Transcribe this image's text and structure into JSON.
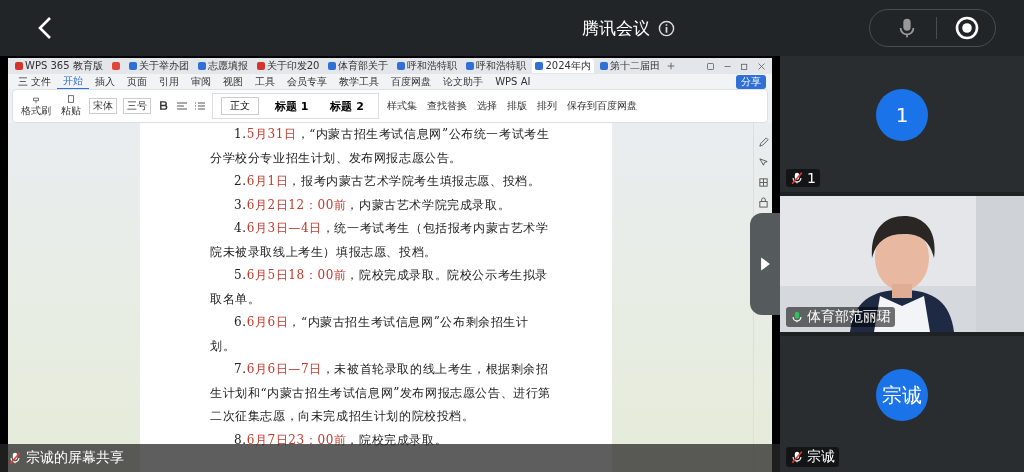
{
  "meeting": {
    "title": "腾讯会议"
  },
  "wps": {
    "tabs": [
      {
        "label": "WPS 365 教育版",
        "selected": false,
        "color": "#d6332a"
      },
      {
        "selected": false,
        "color": "#e0453a"
      },
      {
        "label": "关于举办团",
        "selected": false,
        "color": "#2f6fd6"
      },
      {
        "label": "志愿填报",
        "selected": false,
        "color": "#2f6fd6"
      },
      {
        "label": "关于印发20",
        "selected": false,
        "color": "#d6332a"
      },
      {
        "label": "体育部关于",
        "selected": false,
        "color": "#2f6fd6"
      },
      {
        "label": "呼和浩特职",
        "selected": false,
        "color": "#2f6fd6"
      },
      {
        "label": "呼和浩特职",
        "selected": false,
        "color": "#2f6fd6"
      },
      {
        "label": "2024年内",
        "selected": true,
        "color": "#2f6fd6"
      },
      {
        "label": "第十二届田",
        "selected": false,
        "color": "#2f6fd6"
      }
    ],
    "menu": [
      {
        "label": "三 文件",
        "selected": false
      },
      {
        "label": "开始",
        "selected": true
      },
      {
        "label": "插入",
        "selected": false
      },
      {
        "label": "页面",
        "selected": false
      },
      {
        "label": "引用",
        "selected": false
      },
      {
        "label": "审阅",
        "selected": false
      },
      {
        "label": "视图",
        "selected": false
      },
      {
        "label": "工具",
        "selected": false
      },
      {
        "label": "会员专享",
        "selected": false
      },
      {
        "label": "教学工具",
        "selected": false
      },
      {
        "label": "百度网盘",
        "selected": false
      },
      {
        "label": "论文助手",
        "selected": false
      },
      {
        "label": "WPS AI",
        "selected": false
      }
    ],
    "share_button": "分享",
    "ribbon": {
      "format_painter": "格式刷",
      "paste": "粘贴",
      "font": "宋体",
      "size": "三号",
      "styles": [
        "正文",
        "标题 1",
        "标题 2"
      ],
      "style_set": "样式集",
      "find": "查找替换",
      "select": "选择",
      "layout": "排版",
      "arrange": "排列",
      "save_cloud": "保存到百度网盘"
    }
  },
  "document": {
    "paragraphs": [
      {
        "number": "1.",
        "date": "5月31日",
        "text": "，“内蒙古招生考试信息网”公布统一考试考生分学校分专业招生计划、发布网报志愿公告。"
      },
      {
        "number": "2.",
        "date": "6月1日",
        "text": "，报考内蒙古艺术学院考生填报志愿、投档。"
      },
      {
        "number": "3.",
        "date": "6月2日12：00前",
        "text": "，内蒙古艺术学院完成录取。"
      },
      {
        "number": "4.",
        "date": "6月3日—4日",
        "text": "，统一考试考生（包括报考内蒙古艺术学院未被录取线上考生）填报志愿、投档。"
      },
      {
        "number": "5.",
        "date": "6月5日18：00前",
        "text": "，院校完成录取。院校公示考生拟录取名单。"
      },
      {
        "number": "6.",
        "date": "6月6日",
        "text": "，“内蒙古招生考试信息网”公布剩余招生计划。"
      },
      {
        "number": "7.",
        "date": "6月6日—7日",
        "text": "，未被首轮录取的线上考生，根据剩余招生计划和“内蒙古招生考试信息网”发布网报志愿公告、进行第二次征集志愿，向未完成招生计划的院校投档。"
      },
      {
        "number": "8.",
        "date": "6月7日23：00前",
        "text": "，院校完成录取。"
      }
    ]
  },
  "share_banner": {
    "label": "宗诚的屏幕共享",
    "muted": true
  },
  "participants": [
    {
      "kind": "avatar",
      "initial": "1",
      "name": "1",
      "muted": true
    },
    {
      "kind": "video",
      "name": "体育部范丽珺",
      "muted": false
    },
    {
      "kind": "avatar",
      "initial": "宗诚",
      "name": "宗诚",
      "muted": true
    }
  ]
}
